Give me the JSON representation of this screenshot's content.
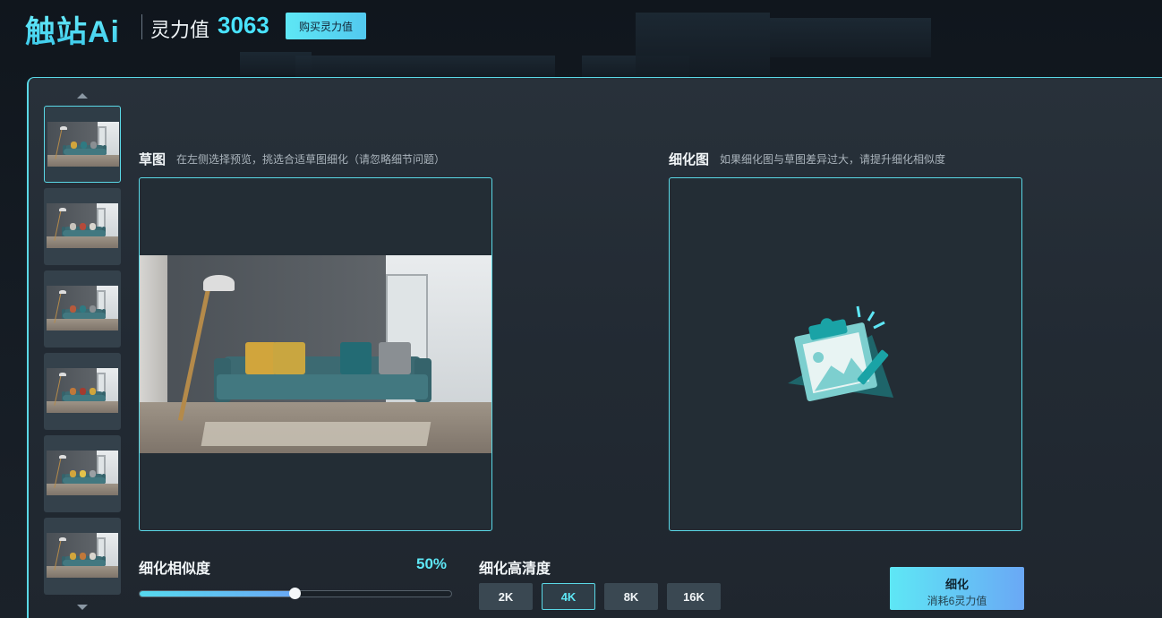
{
  "header": {
    "logo": "触站Ai",
    "power_label": "灵力值",
    "power_value": "3063",
    "buy_button": "购买灵力值"
  },
  "sketch": {
    "title": "草图",
    "hint": "在左侧选择预览，挑选合适草图细化（请忽略细节问题）"
  },
  "refined": {
    "title": "细化图",
    "hint": "如果细化图与草图差异过大，请提升细化相似度"
  },
  "similarity": {
    "label": "细化相似度",
    "value_text": "50%",
    "value": 0.5
  },
  "resolution": {
    "label": "细化高清度",
    "options": [
      "2K",
      "4K",
      "8K",
      "16K"
    ],
    "selected": "4K"
  },
  "refine_button": {
    "label": "细化",
    "cost": "消耗6灵力值"
  },
  "thumbnails": [
    {
      "selected": true,
      "pillows": [
        "#d1a53c",
        "#2f7a82",
        "#8a8f93"
      ]
    },
    {
      "selected": false,
      "pillows": [
        "#c8c3bc",
        "#b54a3a",
        "#d9d5ce"
      ]
    },
    {
      "selected": false,
      "pillows": [
        "#b65a3c",
        "#2f7a82",
        "#8a8f93"
      ]
    },
    {
      "selected": false,
      "pillows": [
        "#c0783a",
        "#a33b2f",
        "#d1a53c"
      ]
    },
    {
      "selected": false,
      "pillows": [
        "#d1a53c",
        "#e3c24a",
        "#9aa0a4"
      ]
    },
    {
      "selected": false,
      "pillows": [
        "#d1a53c",
        "#c0783a",
        "#d9d5ce"
      ]
    }
  ],
  "colors": {
    "accent": "#5ad8e6",
    "accent_text": "#5ee7f5",
    "panel": "#28313a"
  }
}
